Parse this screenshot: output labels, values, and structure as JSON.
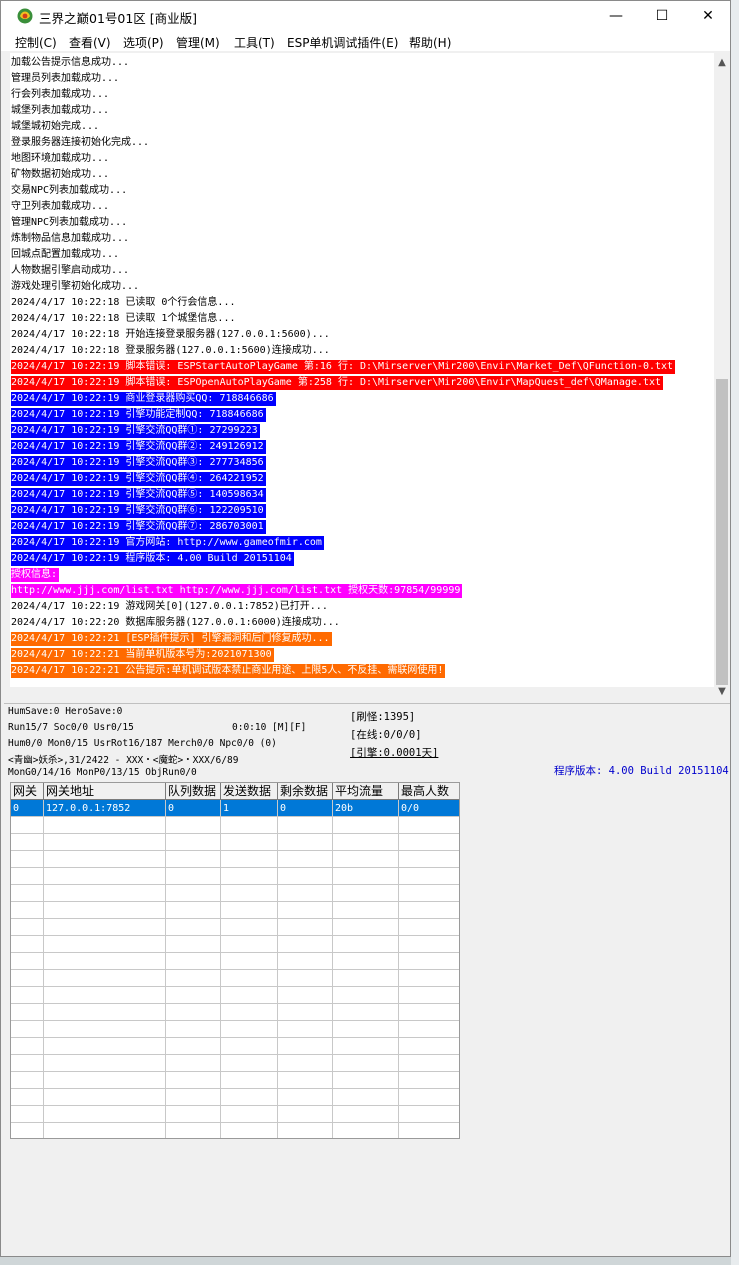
{
  "window": {
    "title": "三界之巅01号01区 [商业版]",
    "minimize_glyph": "—",
    "maximize_glyph": "☐",
    "close_glyph": "✕",
    "app_icon": "game-server-icon"
  },
  "menu": [
    "控制(C)",
    "查看(V)",
    "选项(P)",
    "管理(M)",
    "工具(T)",
    "ESP单机调试插件(E)",
    "帮助(H)"
  ],
  "log": [
    {
      "text": "加载公告提示信息成功...",
      "style": "plain"
    },
    {
      "text": "管理员列表加载成功...",
      "style": "plain"
    },
    {
      "text": "行会列表加载成功...",
      "style": "plain"
    },
    {
      "text": "城堡列表加载成功...",
      "style": "plain"
    },
    {
      "text": "城堡城初始完成...",
      "style": "plain"
    },
    {
      "text": "登录服务器连接初始化完成...",
      "style": "plain"
    },
    {
      "text": "地图环境加载成功...",
      "style": "plain"
    },
    {
      "text": "矿物数据初始成功...",
      "style": "plain"
    },
    {
      "text": "交易NPC列表加载成功...",
      "style": "plain"
    },
    {
      "text": "守卫列表加载成功...",
      "style": "plain"
    },
    {
      "text": "管理NPC列表加载成功...",
      "style": "plain"
    },
    {
      "text": "炼制物品信息加载成功...",
      "style": "plain"
    },
    {
      "text": "回城点配置加载成功...",
      "style": "plain"
    },
    {
      "text": "人物数据引擎启动成功...",
      "style": "plain"
    },
    {
      "text": "游戏处理引擎初始化成功...",
      "style": "plain"
    },
    {
      "text": "2024/4/17 10:22:18 已读取 0个行会信息...",
      "style": "plain"
    },
    {
      "text": "2024/4/17 10:22:18 已读取 1个城堡信息...",
      "style": "plain"
    },
    {
      "text": "2024/4/17 10:22:18 开始连接登录服务器(127.0.0.1:5600)...",
      "style": "plain"
    },
    {
      "text": "2024/4/17 10:22:18 登录服务器(127.0.0.1:5600)连接成功...",
      "style": "plain"
    },
    {
      "text": "2024/4/17 10:22:19 脚本错误: ESPStartAutoPlayGame 第:16 行: D:\\Mirserver\\Mir200\\Envir\\Market_Def\\QFunction-0.txt",
      "style": "red"
    },
    {
      "text": "2024/4/17 10:22:19 脚本错误: ESPOpenAutoPlayGame 第:258 行: D:\\Mirserver\\Mir200\\Envir\\MapQuest_def\\QManage.txt",
      "style": "red"
    },
    {
      "text": "2024/4/17 10:22:19 商业登录器购买QQ: 718846686",
      "style": "blue"
    },
    {
      "text": "2024/4/17 10:22:19 引擎功能定制QQ: 718846686",
      "style": "blue"
    },
    {
      "text": "2024/4/17 10:22:19 引擎交流QQ群①: 27299223",
      "style": "blue"
    },
    {
      "text": "2024/4/17 10:22:19 引擎交流QQ群②: 249126912",
      "style": "blue"
    },
    {
      "text": "2024/4/17 10:22:19 引擎交流QQ群③: 277734856",
      "style": "blue"
    },
    {
      "text": "2024/4/17 10:22:19 引擎交流QQ群④: 264221952",
      "style": "blue"
    },
    {
      "text": "2024/4/17 10:22:19 引擎交流QQ群⑤: 140598634",
      "style": "blue"
    },
    {
      "text": "2024/4/17 10:22:19 引擎交流QQ群⑥: 122209510",
      "style": "blue"
    },
    {
      "text": "2024/4/17 10:22:19 引擎交流QQ群⑦: 286703001",
      "style": "blue"
    },
    {
      "text": "2024/4/17 10:22:19 官方网站: http://www.gameofmir.com",
      "style": "blue"
    },
    {
      "text": "2024/4/17 10:22:19 程序版本: 4.00 Build 20151104",
      "style": "blue"
    },
    {
      "text": "授权信息:",
      "style": "magenta"
    },
    {
      "text": "http://www.jjj.com/list.txt http://www.jjj.com/list.txt 授权天数:97854/99999",
      "style": "magenta"
    },
    {
      "text": "2024/4/17 10:22:19 游戏网关[0](127.0.0.1:7852)已打开...",
      "style": "plain"
    },
    {
      "text": "2024/4/17 10:22:20 数据库服务器(127.0.0.1:6000)连接成功...",
      "style": "plain"
    },
    {
      "text": "2024/4/17 10:22:21 [ESP插件提示] 引擎漏洞和后门修复成功...",
      "style": "orange"
    },
    {
      "text": "2024/4/17 10:22:21 当前单机版本号为:2021071300",
      "style": "orange"
    },
    {
      "text": "2024/4/17 10:22:21 公告提示:单机调试版本禁止商业用途、上限5人、不反挂、需联网使用!",
      "style": "orange"
    }
  ],
  "status": {
    "line1": "HumSave:0 HeroSave:0",
    "line2": "Run15/7 Soc0/0 Usr0/15",
    "timer": "0:0:10 [M][F]",
    "line3": "Hum0/0 Mon0/15 UsrRot16/187 Merch0/0 Npc0/0 (0)",
    "line4": "<青幽>妖杀>,31/2422 - XXX・<魔蛇>・XXX/6/89",
    "line5": "MonG0/14/16 MonP0/13/15 ObjRun0/0",
    "refresh": "[刷怪:1395]",
    "online": "[在线:0/0/0]",
    "engine": "[引擎:0.0001天]",
    "version": "程序版本: 4.00 Build 20151104"
  },
  "gateway_table": {
    "headers": [
      "网关",
      "网关地址",
      "队列数据",
      "发送数据",
      "剩余数据",
      "平均流量",
      "最高人数"
    ],
    "rows": [
      [
        "0",
        "127.0.0.1:7852",
        "0",
        "1",
        "0",
        "20b",
        "0/0"
      ]
    ]
  }
}
